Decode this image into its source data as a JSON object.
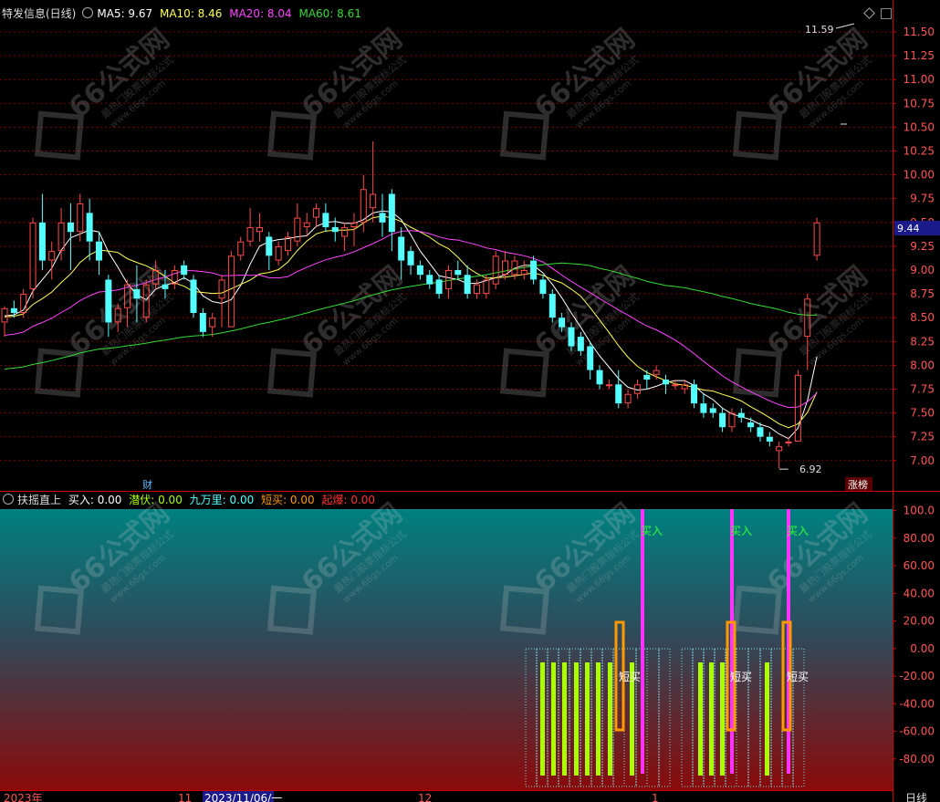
{
  "colors": {
    "up": "#ff4a4a",
    "down": "#54ffff",
    "ma5": "#ffffff",
    "ma10": "#ffff55",
    "ma20": "#ff44ff",
    "ma60": "#33dd33",
    "grid": "#7a0000",
    "axis": "#cc0000",
    "magenta": "#ff33ff",
    "orange": "#ff9900",
    "lime": "#aaff00"
  },
  "main_header": {
    "title": "特发信息(日线)",
    "ma5": "MA5: 9.67",
    "ma10": "MA10: 8.46",
    "ma20": "MA20: 8.04",
    "ma60": "MA60: 8.61"
  },
  "price_axis": {
    "ticks": [
      "11.50",
      "11.25",
      "11.00",
      "10.75",
      "10.50",
      "10.25",
      "10.00",
      "9.75",
      "9.50",
      "9.25",
      "9.00",
      "8.75",
      "8.50",
      "8.25",
      "8.00",
      "7.75",
      "7.50",
      "7.25",
      "7.00"
    ],
    "current": "9.44"
  },
  "annotations": {
    "high": "11.59",
    "low": "6.92",
    "cai": "财",
    "zhang_bang": "涨榜"
  },
  "indicator_header": {
    "title": "扶摇直上",
    "buy": "买入: 0.00",
    "qianfu": "潜伏: 0.00",
    "jiuwanli": "九万里: 0.00",
    "duanmai": "短买: 0.00",
    "qibao": "起爆: 0.00"
  },
  "indicator_axis": {
    "ticks": [
      "100.0",
      "80.00",
      "60.00",
      "40.00",
      "20.00",
      "0.00",
      "-20.00",
      "-40.00",
      "-60.00",
      "-80.00"
    ]
  },
  "signals": {
    "buy_label": "买入",
    "short_label": "短买"
  },
  "date_axis": {
    "labels": [
      "2023年",
      "11",
      "2023/11/06/一",
      "12",
      "1"
    ],
    "period": "日线"
  },
  "watermark": {
    "brand": "66公式网",
    "sub": "最热门股票指标公式",
    "url": "www.66gs.com"
  },
  "chart_data": {
    "type": "candlestick",
    "ylim": [
      6.85,
      11.65
    ],
    "ohlc": [
      [
        8.45,
        8.62,
        8.3,
        8.6
      ],
      [
        8.6,
        8.68,
        8.5,
        8.55
      ],
      [
        8.55,
        8.8,
        8.5,
        8.75
      ],
      [
        8.8,
        9.55,
        8.7,
        9.5
      ],
      [
        9.5,
        9.8,
        9.0,
        9.1
      ],
      [
        9.1,
        9.3,
        8.9,
        9.2
      ],
      [
        9.2,
        9.65,
        9.1,
        9.5
      ],
      [
        9.5,
        9.7,
        9.0,
        9.4
      ],
      [
        9.4,
        9.8,
        9.3,
        9.7
      ],
      [
        9.6,
        9.75,
        9.1,
        9.3
      ],
      [
        9.3,
        9.4,
        8.95,
        9.1
      ],
      [
        8.9,
        8.95,
        8.3,
        8.45
      ],
      [
        8.45,
        8.65,
        8.35,
        8.6
      ],
      [
        8.6,
        8.9,
        8.4,
        8.85
      ],
      [
        8.8,
        9.05,
        8.45,
        8.7
      ],
      [
        8.5,
        8.9,
        8.45,
        8.85
      ],
      [
        8.85,
        9.1,
        8.8,
        9.0
      ],
      [
        8.85,
        9.0,
        8.7,
        8.8
      ],
      [
        8.85,
        9.05,
        8.8,
        9.0
      ],
      [
        9.05,
        9.1,
        8.9,
        8.95
      ],
      [
        8.9,
        8.95,
        8.5,
        8.55
      ],
      [
        8.55,
        8.6,
        8.3,
        8.35
      ],
      [
        8.4,
        8.55,
        8.3,
        8.5
      ],
      [
        8.7,
        8.95,
        8.4,
        8.9
      ],
      [
        8.4,
        9.2,
        8.4,
        9.15
      ],
      [
        9.15,
        9.35,
        9.1,
        9.3
      ],
      [
        9.3,
        9.65,
        9.25,
        9.45
      ],
      [
        9.4,
        9.6,
        9.3,
        9.45
      ],
      [
        9.35,
        9.4,
        9.0,
        9.15
      ],
      [
        9.1,
        9.3,
        9.05,
        9.25
      ],
      [
        9.2,
        9.4,
        9.15,
        9.35
      ],
      [
        9.3,
        9.7,
        9.25,
        9.55
      ],
      [
        9.45,
        9.6,
        9.35,
        9.5
      ],
      [
        9.55,
        9.7,
        9.45,
        9.65
      ],
      [
        9.6,
        9.7,
        9.4,
        9.45
      ],
      [
        9.45,
        9.55,
        9.3,
        9.4
      ],
      [
        9.35,
        9.5,
        9.2,
        9.45
      ],
      [
        9.45,
        9.6,
        9.25,
        9.5
      ],
      [
        9.5,
        10.0,
        9.4,
        9.85
      ],
      [
        9.65,
        10.35,
        9.5,
        9.8
      ],
      [
        9.6,
        9.8,
        9.35,
        9.5
      ],
      [
        9.8,
        9.85,
        9.2,
        9.4
      ],
      [
        9.35,
        9.45,
        8.9,
        9.1
      ],
      [
        9.2,
        9.25,
        8.95,
        9.05
      ],
      [
        9.05,
        9.1,
        8.9,
        8.95
      ],
      [
        8.95,
        9.0,
        8.8,
        8.85
      ],
      [
        8.9,
        8.95,
        8.7,
        8.75
      ],
      [
        8.8,
        9.05,
        8.7,
        9.0
      ],
      [
        9.0,
        9.1,
        8.9,
        8.95
      ],
      [
        8.95,
        9.05,
        8.7,
        8.75
      ],
      [
        8.75,
        8.9,
        8.7,
        8.85
      ],
      [
        8.75,
        8.95,
        8.7,
        8.9
      ],
      [
        8.85,
        9.2,
        8.8,
        9.15
      ],
      [
        8.95,
        9.2,
        8.9,
        9.1
      ],
      [
        8.95,
        9.15,
        8.9,
        9.1
      ],
      [
        8.95,
        9.1,
        8.9,
        9.0
      ],
      [
        9.1,
        9.15,
        8.85,
        8.9
      ],
      [
        8.9,
        8.95,
        8.7,
        8.75
      ],
      [
        8.75,
        8.8,
        8.45,
        8.5
      ],
      [
        8.5,
        8.55,
        8.35,
        8.4
      ],
      [
        8.4,
        8.45,
        8.15,
        8.2
      ],
      [
        8.3,
        8.35,
        8.1,
        8.15
      ],
      [
        8.2,
        8.25,
        7.85,
        7.95
      ],
      [
        7.95,
        8.0,
        7.75,
        7.8
      ],
      [
        7.8,
        7.85,
        7.75,
        7.8
      ],
      [
        7.8,
        7.95,
        7.55,
        7.6
      ],
      [
        7.6,
        7.75,
        7.55,
        7.7
      ],
      [
        7.7,
        7.85,
        7.65,
        7.8
      ],
      [
        7.9,
        7.95,
        7.75,
        7.85
      ],
      [
        7.9,
        8.0,
        7.85,
        7.95
      ],
      [
        7.85,
        7.9,
        7.7,
        7.8
      ],
      [
        7.8,
        7.85,
        7.75,
        7.8
      ],
      [
        7.75,
        7.85,
        7.7,
        7.8
      ],
      [
        7.8,
        7.85,
        7.55,
        7.6
      ],
      [
        7.6,
        7.7,
        7.45,
        7.5
      ],
      [
        7.55,
        7.6,
        7.45,
        7.5
      ],
      [
        7.5,
        7.55,
        7.3,
        7.35
      ],
      [
        7.35,
        7.55,
        7.3,
        7.5
      ],
      [
        7.5,
        7.55,
        7.4,
        7.45
      ],
      [
        7.4,
        7.45,
        7.3,
        7.35
      ],
      [
        7.35,
        7.4,
        7.2,
        7.25
      ],
      [
        7.25,
        7.3,
        7.15,
        7.2
      ],
      [
        7.1,
        7.2,
        6.92,
        7.15
      ],
      [
        7.2,
        7.25,
        7.15,
        7.2
      ],
      [
        7.2,
        7.95,
        7.2,
        7.9
      ],
      [
        8.3,
        8.75,
        7.95,
        8.7
      ],
      [
        9.15,
        9.55,
        9.1,
        9.5
      ]
    ]
  }
}
